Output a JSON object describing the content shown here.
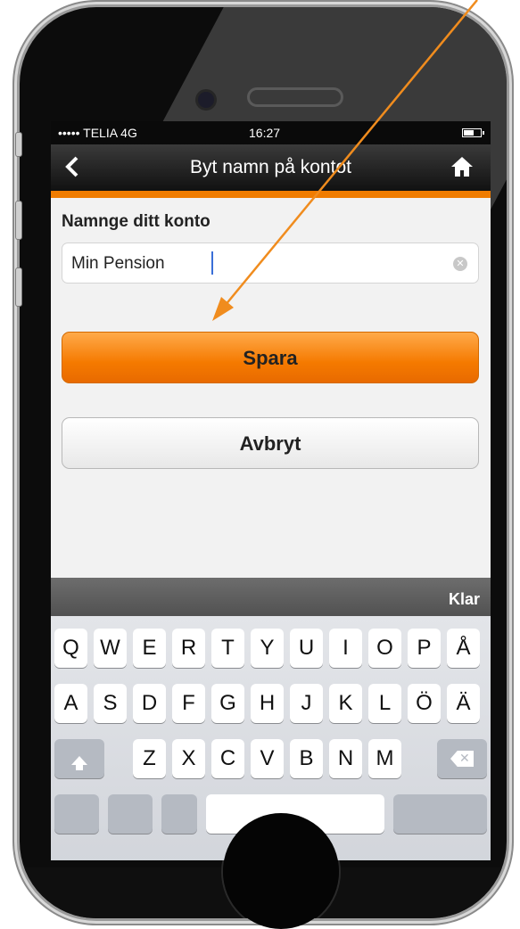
{
  "status_bar": {
    "carrier": "••••• TELIA  4G",
    "time": "16:27"
  },
  "nav": {
    "title": "Byt namn på kontot",
    "back_icon": "chevron-left-icon",
    "home_icon": "home-icon"
  },
  "form": {
    "label": "Namnge ditt konto",
    "value": "Min Pension",
    "clear_icon": "clear-icon"
  },
  "buttons": {
    "save": "Spara",
    "cancel": "Avbryt"
  },
  "accessory": {
    "done": "Klar"
  },
  "keyboard": {
    "row1": [
      "Q",
      "W",
      "E",
      "R",
      "T",
      "Y",
      "U",
      "I",
      "O",
      "P",
      "Å"
    ],
    "row2": [
      "A",
      "S",
      "D",
      "F",
      "G",
      "H",
      "J",
      "K",
      "L",
      "Ö",
      "Ä"
    ],
    "row3": [
      "Z",
      "X",
      "C",
      "V",
      "B",
      "N",
      "M"
    ],
    "shift_icon": "shift-icon",
    "delete_icon": "delete-icon"
  },
  "colors": {
    "accent": "#f57a00",
    "arrow": "#f08c1e",
    "nav_bg": "#1a1a1a"
  }
}
